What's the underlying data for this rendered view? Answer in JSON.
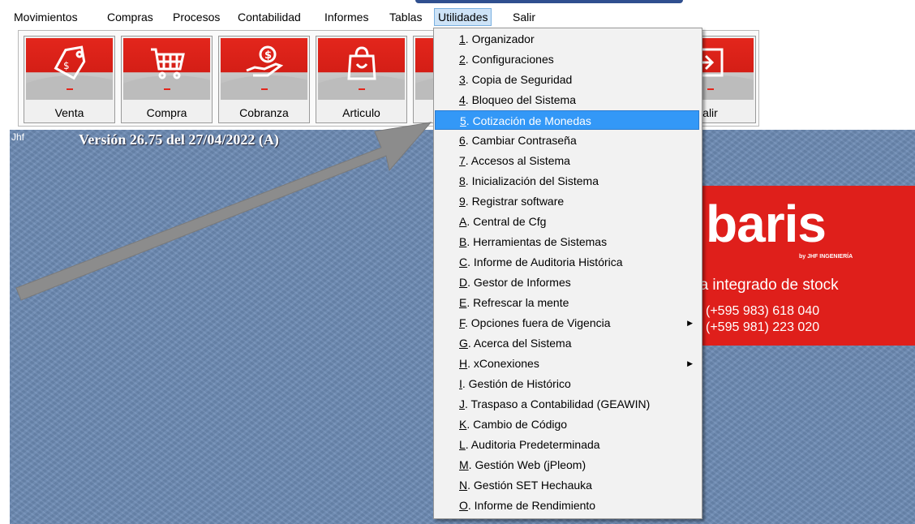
{
  "menubar": {
    "items": [
      "Movimientos",
      "Compras",
      "Procesos",
      "Contabilidad",
      "Informes",
      "Tablas",
      "Utilidades",
      "Salir"
    ],
    "active_index": 6
  },
  "toolbar": {
    "buttons": [
      {
        "label": "Venta",
        "icon": "tag-icon"
      },
      {
        "label": "Compra",
        "icon": "shopping-cart-icon"
      },
      {
        "label": "Cobranza",
        "icon": "hand-coin-icon"
      },
      {
        "label": "Articulo",
        "icon": "shopping-bag-icon"
      },
      {
        "label": "",
        "icon": "hidden-button"
      },
      {
        "label": "alir",
        "icon": "exit-icon"
      }
    ]
  },
  "desktop": {
    "user": "Jhf",
    "version": "Versión 26.75 del 27/04/2022  (A)",
    "brand": {
      "logo": "baris",
      "byline": "by JHF INGENIERÍA",
      "tagline": "na integrado de stock",
      "phone1": "(+595 983) 618 040",
      "phone2": "(+595 981) 223 020"
    }
  },
  "dropdown": {
    "highlighted_index": 4,
    "items": [
      {
        "key": "1",
        "text": ". Organizador"
      },
      {
        "key": "2",
        "text": ". Configuraciones"
      },
      {
        "key": "3",
        "text": ". Copia de Seguridad"
      },
      {
        "key": "4",
        "text": ". Bloqueo del Sistema"
      },
      {
        "key": "5",
        "text": ". Cotización de Monedas"
      },
      {
        "key": "6",
        "text": ". Cambiar Contraseña"
      },
      {
        "key": "7",
        "text": ". Accesos al Sistema"
      },
      {
        "key": "8",
        "text": ". Inicialización del Sistema"
      },
      {
        "key": "9",
        "text": ". Registrar software"
      },
      {
        "key": "A",
        "text": ". Central de Cfg"
      },
      {
        "key": "B",
        "text": ". Herramientas de Sistemas"
      },
      {
        "key": "C",
        "text": ". Informe de Auditoria Histórica"
      },
      {
        "key": "D",
        "text": ". Gestor de Informes"
      },
      {
        "key": "E",
        "text": ". Refrescar la mente"
      },
      {
        "key": "F",
        "text": ". Opciones fuera de Vigencia",
        "submenu": true
      },
      {
        "key": "G",
        "text": ". Acerca del Sistema"
      },
      {
        "key": "H",
        "text": ". xConexiones",
        "submenu": true
      },
      {
        "key": "I",
        "text": ". Gestión de Histórico"
      },
      {
        "key": "J",
        "text": ". Traspaso a Contabilidad (GEAWIN)"
      },
      {
        "key": "K",
        "text": ". Cambio de Código"
      },
      {
        "key": "L",
        "text": ". Auditoria Predeterminada"
      },
      {
        "key": "M",
        "text": ". Gestión Web (jPleom)"
      },
      {
        "key": "N",
        "text": ". Gestión SET Hechauka"
      },
      {
        "key": "O",
        "text": ". Informe de Rendimiento"
      }
    ]
  },
  "colors": {
    "highlight": "#3398f7",
    "desktop": "#6d8bb4",
    "brand_red": "#df1f1b",
    "button_red": "#e3261c",
    "arrow": "#8c8c8c"
  }
}
